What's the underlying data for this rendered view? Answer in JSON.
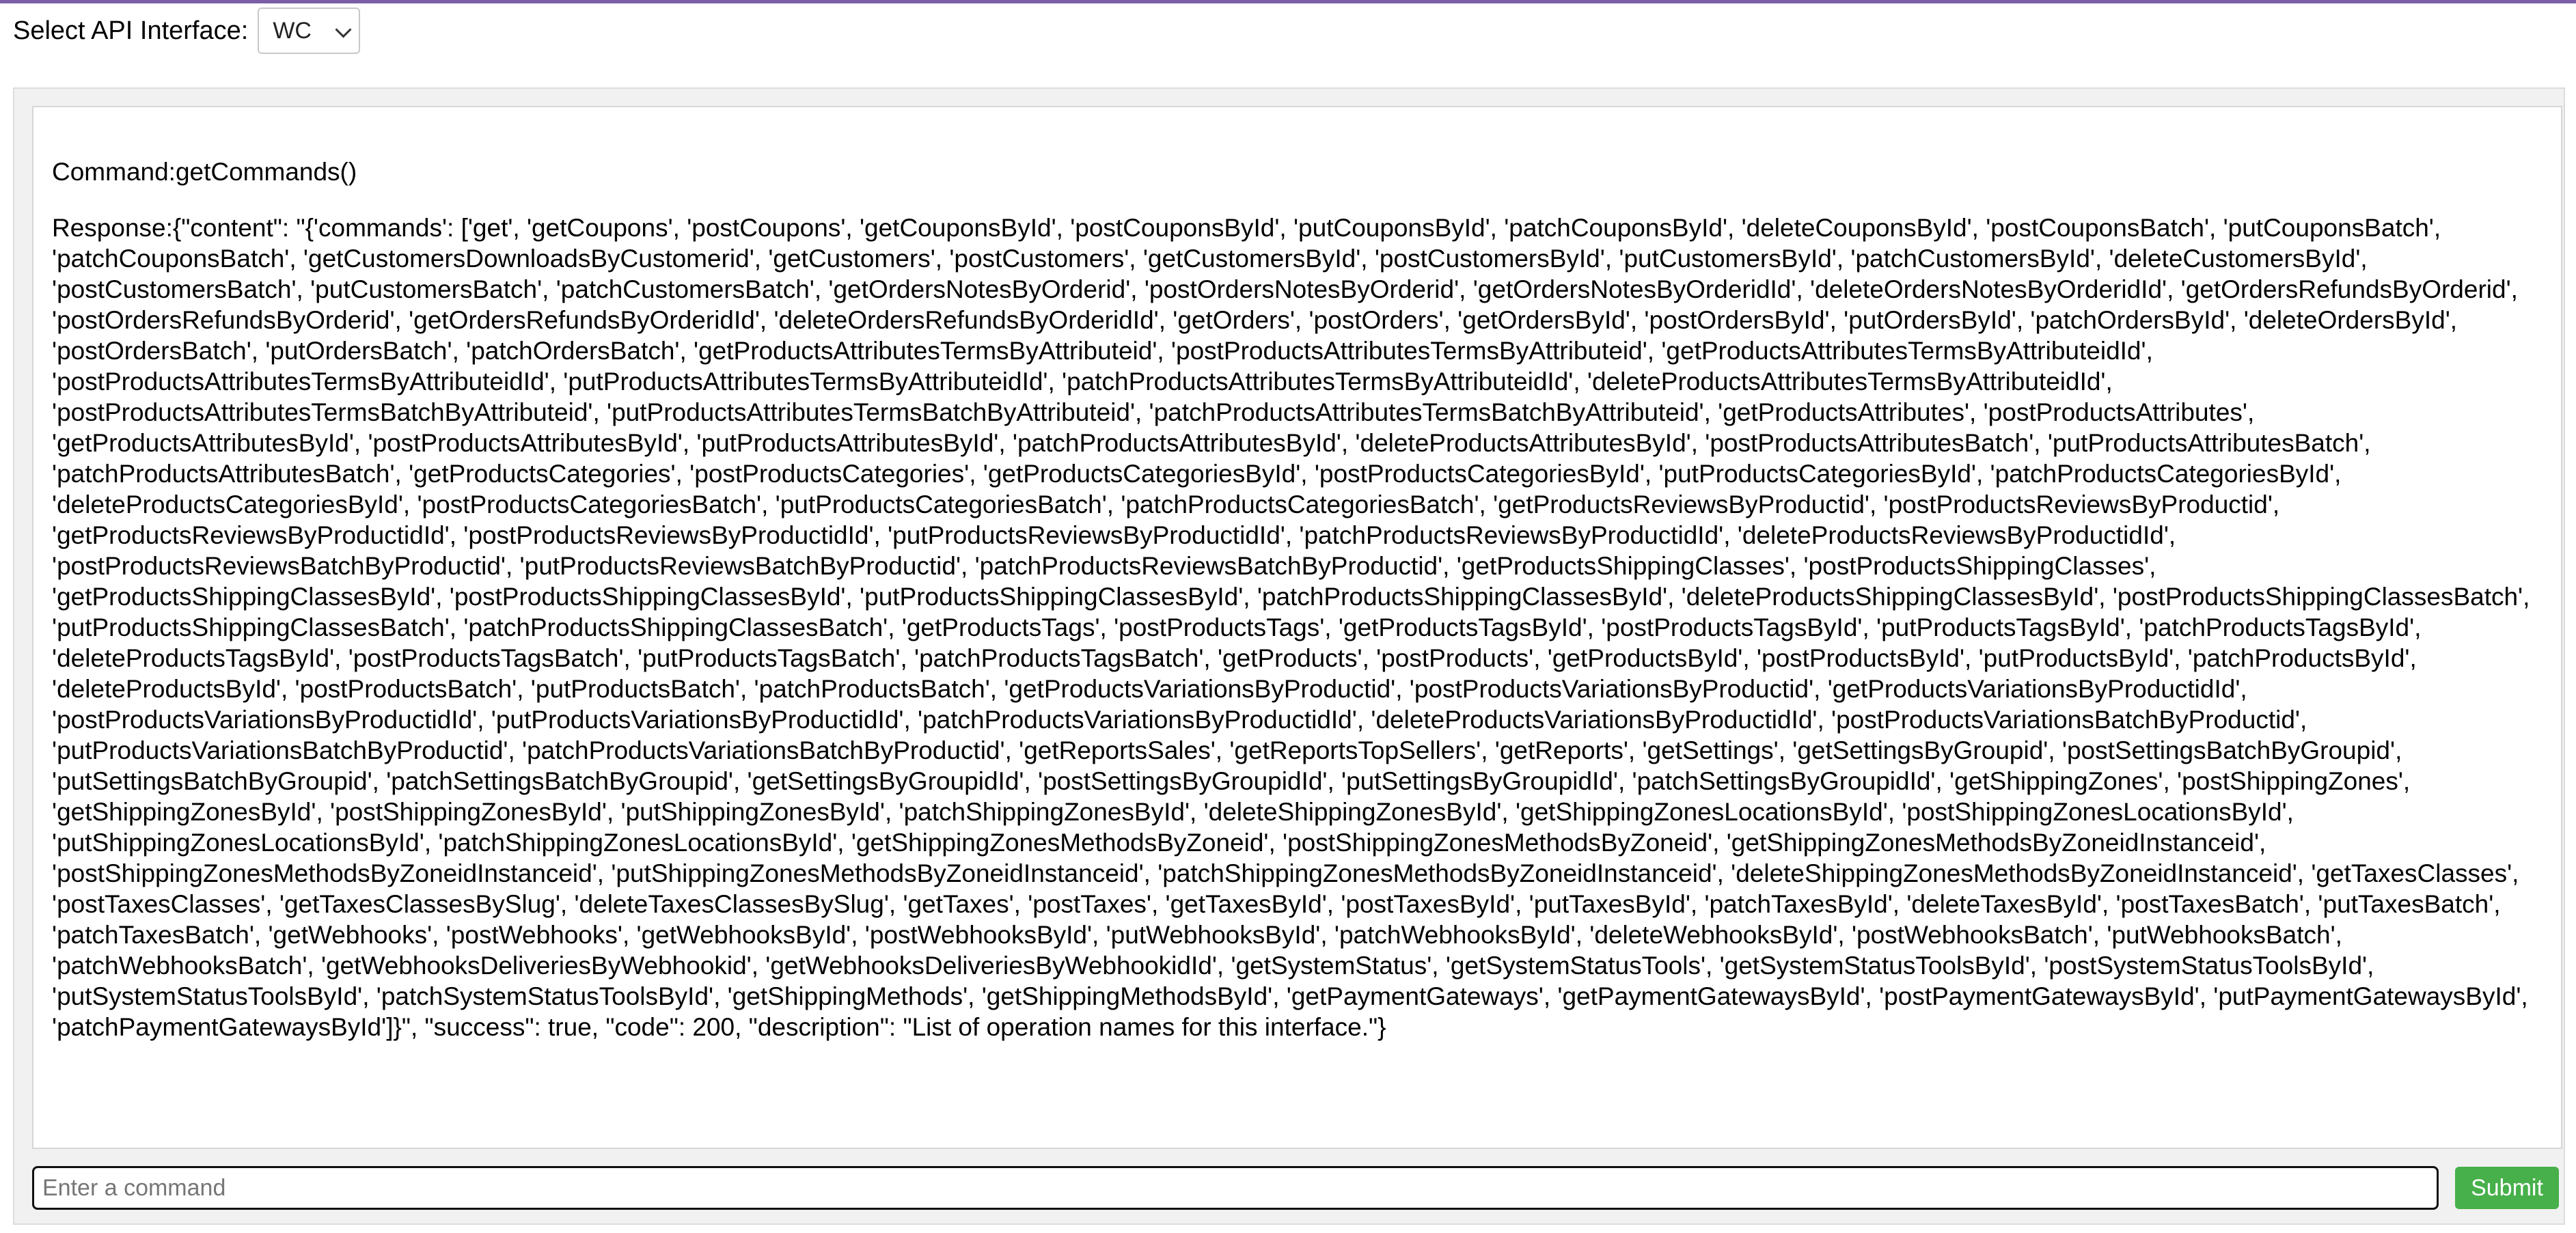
{
  "header": {
    "select_label": "Select API Interface:",
    "select_value": "WC"
  },
  "colors": {
    "accent_bar": "#7b5ea7",
    "submit_button": "#47b04b"
  },
  "output": {
    "command": "Command:getCommands()",
    "response": "Response:{\"content\": \"{'commands': ['get', 'getCoupons', 'postCoupons', 'getCouponsById', 'postCouponsById', 'putCouponsById', 'patchCouponsById', 'deleteCouponsById', 'postCouponsBatch', 'putCouponsBatch', 'patchCouponsBatch', 'getCustomersDownloadsByCustomerid', 'getCustomers', 'postCustomers', 'getCustomersById', 'postCustomersById', 'putCustomersById', 'patchCustomersById', 'deleteCustomersById', 'postCustomersBatch', 'putCustomersBatch', 'patchCustomersBatch', 'getOrdersNotesByOrderid', 'postOrdersNotesByOrderid', 'getOrdersNotesByOrderidId', 'deleteOrdersNotesByOrderidId', 'getOrdersRefundsByOrderid', 'postOrdersRefundsByOrderid', 'getOrdersRefundsByOrderidId', 'deleteOrdersRefundsByOrderidId', 'getOrders', 'postOrders', 'getOrdersById', 'postOrdersById', 'putOrdersById', 'patchOrdersById', 'deleteOrdersById', 'postOrdersBatch', 'putOrdersBatch', 'patchOrdersBatch', 'getProductsAttributesTermsByAttributeid', 'postProductsAttributesTermsByAttributeid', 'getProductsAttributesTermsByAttributeidId', 'postProductsAttributesTermsByAttributeidId', 'putProductsAttributesTermsByAttributeidId', 'patchProductsAttributesTermsByAttributeidId', 'deleteProductsAttributesTermsByAttributeidId', 'postProductsAttributesTermsBatchByAttributeid', 'putProductsAttributesTermsBatchByAttributeid', 'patchProductsAttributesTermsBatchByAttributeid', 'getProductsAttributes', 'postProductsAttributes', 'getProductsAttributesById', 'postProductsAttributesById', 'putProductsAttributesById', 'patchProductsAttributesById', 'deleteProductsAttributesById', 'postProductsAttributesBatch', 'putProductsAttributesBatch', 'patchProductsAttributesBatch', 'getProductsCategories', 'postProductsCategories', 'getProductsCategoriesById', 'postProductsCategoriesById', 'putProductsCategoriesById', 'patchProductsCategoriesById', 'deleteProductsCategoriesById', 'postProductsCategoriesBatch', 'putProductsCategoriesBatch', 'patchProductsCategoriesBatch', 'getProductsReviewsByProductid', 'postProductsReviewsByProductid', 'getProductsReviewsByProductidId', 'postProductsReviewsByProductidId', 'putProductsReviewsByProductidId', 'patchProductsReviewsByProductidId', 'deleteProductsReviewsByProductidId', 'postProductsReviewsBatchByProductid', 'putProductsReviewsBatchByProductid', 'patchProductsReviewsBatchByProductid', 'getProductsShippingClasses', 'postProductsShippingClasses', 'getProductsShippingClassesById', 'postProductsShippingClassesById', 'putProductsShippingClassesById', 'patchProductsShippingClassesById', 'deleteProductsShippingClassesById', 'postProductsShippingClassesBatch', 'putProductsShippingClassesBatch', 'patchProductsShippingClassesBatch', 'getProductsTags', 'postProductsTags', 'getProductsTagsById', 'postProductsTagsById', 'putProductsTagsById', 'patchProductsTagsById', 'deleteProductsTagsById', 'postProductsTagsBatch', 'putProductsTagsBatch', 'patchProductsTagsBatch', 'getProducts', 'postProducts', 'getProductsById', 'postProductsById', 'putProductsById', 'patchProductsById', 'deleteProductsById', 'postProductsBatch', 'putProductsBatch', 'patchProductsBatch', 'getProductsVariationsByProductid', 'postProductsVariationsByProductid', 'getProductsVariationsByProductidId', 'postProductsVariationsByProductidId', 'putProductsVariationsByProductidId', 'patchProductsVariationsByProductidId', 'deleteProductsVariationsByProductidId', 'postProductsVariationsBatchByProductid', 'putProductsVariationsBatchByProductid', 'patchProductsVariationsBatchByProductid', 'getReportsSales', 'getReportsTopSellers', 'getReports', 'getSettings', 'getSettingsByGroupid', 'postSettingsBatchByGroupid', 'putSettingsBatchByGroupid', 'patchSettingsBatchByGroupid', 'getSettingsByGroupidId', 'postSettingsByGroupidId', 'putSettingsByGroupidId', 'patchSettingsByGroupidId', 'getShippingZones', 'postShippingZones', 'getShippingZonesById', 'postShippingZonesById', 'putShippingZonesById', 'patchShippingZonesById', 'deleteShippingZonesById', 'getShippingZonesLocationsById', 'postShippingZonesLocationsById', 'putShippingZonesLocationsById', 'patchShippingZonesLocationsById', 'getShippingZonesMethodsByZoneid', 'postShippingZonesMethodsByZoneid', 'getShippingZonesMethodsByZoneidInstanceid', 'postShippingZonesMethodsByZoneidInstanceid', 'putShippingZonesMethodsByZoneidInstanceid', 'patchShippingZonesMethodsByZoneidInstanceid', 'deleteShippingZonesMethodsByZoneidInstanceid', 'getTaxesClasses', 'postTaxesClasses', 'getTaxesClassesBySlug', 'deleteTaxesClassesBySlug', 'getTaxes', 'postTaxes', 'getTaxesById', 'postTaxesById', 'putTaxesById', 'patchTaxesById', 'deleteTaxesById', 'postTaxesBatch', 'putTaxesBatch', 'patchTaxesBatch', 'getWebhooks', 'postWebhooks', 'getWebhooksById', 'postWebhooksById', 'putWebhooksById', 'patchWebhooksById', 'deleteWebhooksById', 'postWebhooksBatch', 'putWebhooksBatch', 'patchWebhooksBatch', 'getWebhooksDeliveriesByWebhookid', 'getWebhooksDeliveriesByWebhookidId', 'getSystemStatus', 'getSystemStatusTools', 'getSystemStatusToolsById', 'postSystemStatusToolsById', 'putSystemStatusToolsById', 'patchSystemStatusToolsById', 'getShippingMethods', 'getShippingMethodsById', 'getPaymentGateways', 'getPaymentGatewaysById', 'postPaymentGatewaysById', 'putPaymentGatewaysById', 'patchPaymentGatewaysById']}\", \"success\": true, \"code\": 200, \"description\": \"List of operation names for this interface.\"}"
  },
  "command_input": {
    "placeholder": "Enter a command",
    "value": ""
  },
  "submit": {
    "label": "Submit"
  }
}
